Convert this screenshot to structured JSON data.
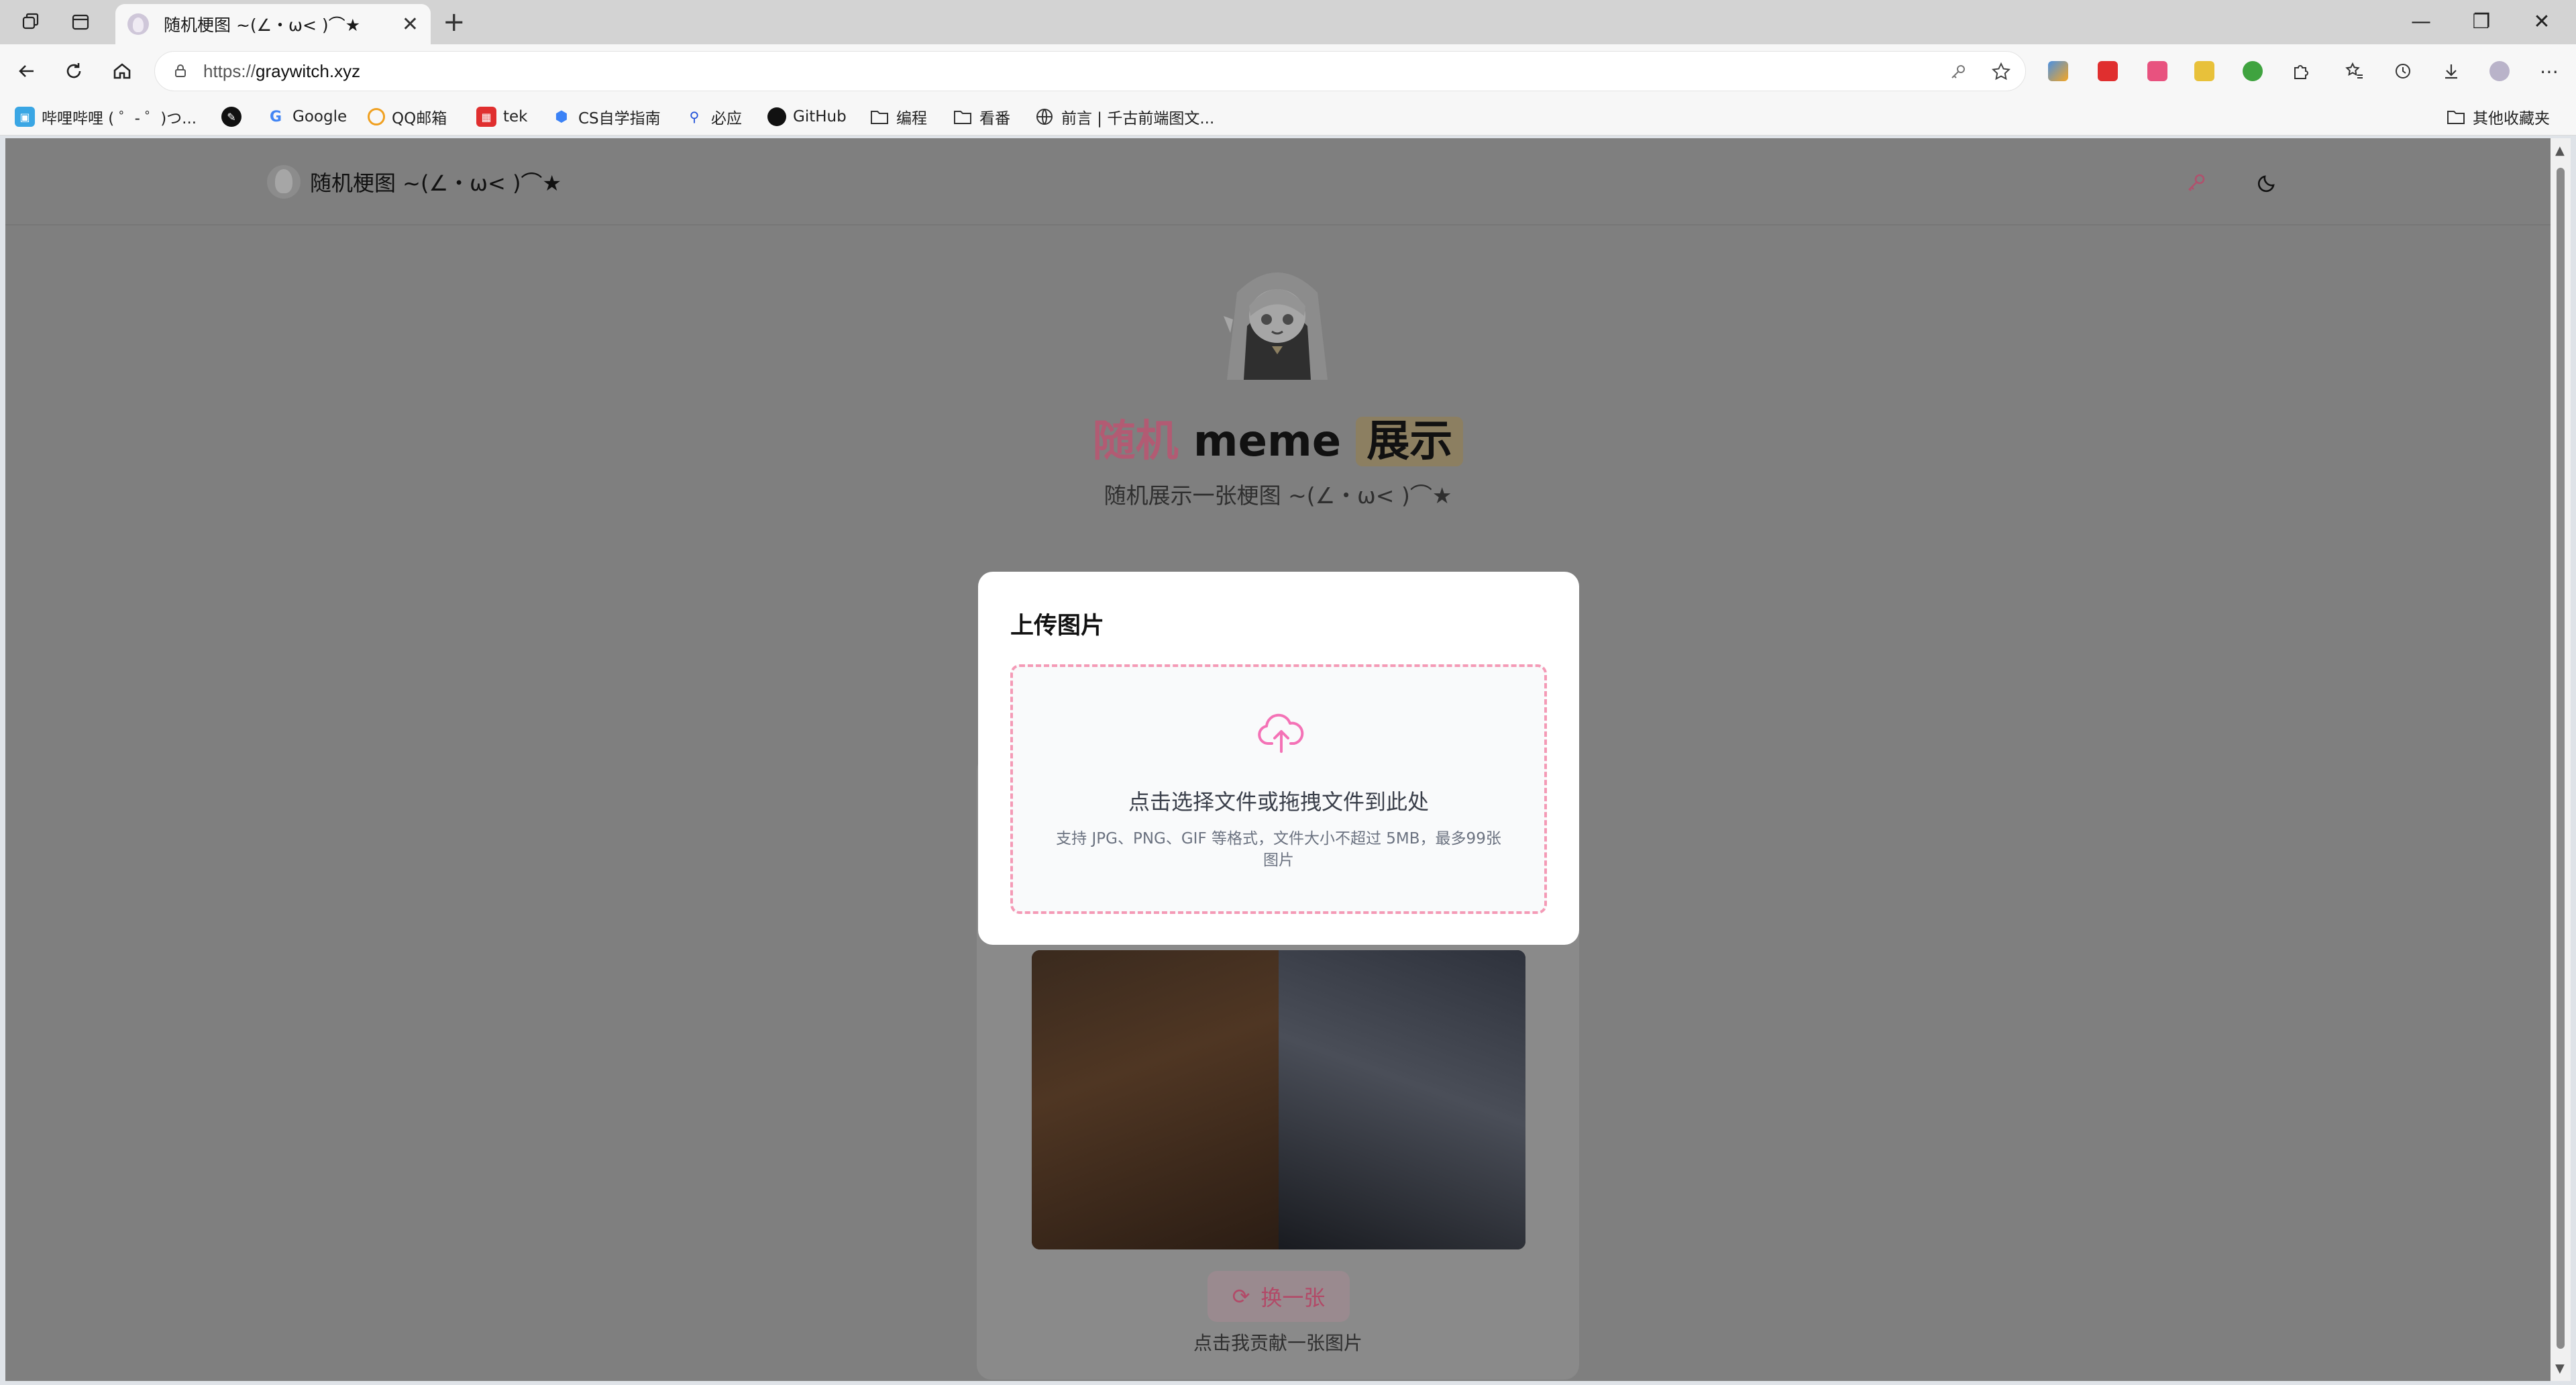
{
  "browser": {
    "tab": {
      "title": "随机梗图 ~(∠・ω< )⌒★",
      "close": "✕"
    },
    "new_tab": "+",
    "url_prefix": "https://",
    "url_host": "graywitch.xyz",
    "window_controls": {
      "minimize": "—",
      "restore": "❐",
      "close": "✕"
    }
  },
  "bookmarks": [
    {
      "label": "哔哩哔哩 ( ゜- ゜)つ...",
      "icon": "bilibili-icon"
    },
    {
      "label": "",
      "icon": "pen-circle-icon"
    },
    {
      "label": "Google",
      "icon": "google-icon"
    },
    {
      "label": "QQ邮箱",
      "icon": "qq-mail-icon"
    },
    {
      "label": "tek",
      "icon": "tek-icon"
    },
    {
      "label": "CS自学指南",
      "icon": "cube-icon"
    },
    {
      "label": "必应",
      "icon": "bing-search-icon"
    },
    {
      "label": "GitHub",
      "icon": "github-icon"
    },
    {
      "label": "编程",
      "icon": "folder-icon"
    },
    {
      "label": "看番",
      "icon": "folder-icon"
    },
    {
      "label": "前言 | 千古前端图文...",
      "icon": "globe-icon"
    }
  ],
  "other_bookmarks": "其他收藏夹",
  "site": {
    "brand": "随机梗图 ~(∠・ω< )⌒★",
    "hero": {
      "title_part1": "随机",
      "title_part2": "meme",
      "title_part3": "展示",
      "subtitle": "随机展示一张梗图 ~(∠・ω< )⌒★"
    },
    "swap_button": "换一张",
    "contribute_link": "点击我贡献一张图片",
    "accent_color": "#f472b6"
  },
  "modal": {
    "title": "上传图片",
    "dropzone_text": "点击选择文件或拖拽文件到此处",
    "dropzone_hint": "支持 JPG、PNG、GIF 等格式，文件大小不超过 5MB，最多99张图片"
  }
}
